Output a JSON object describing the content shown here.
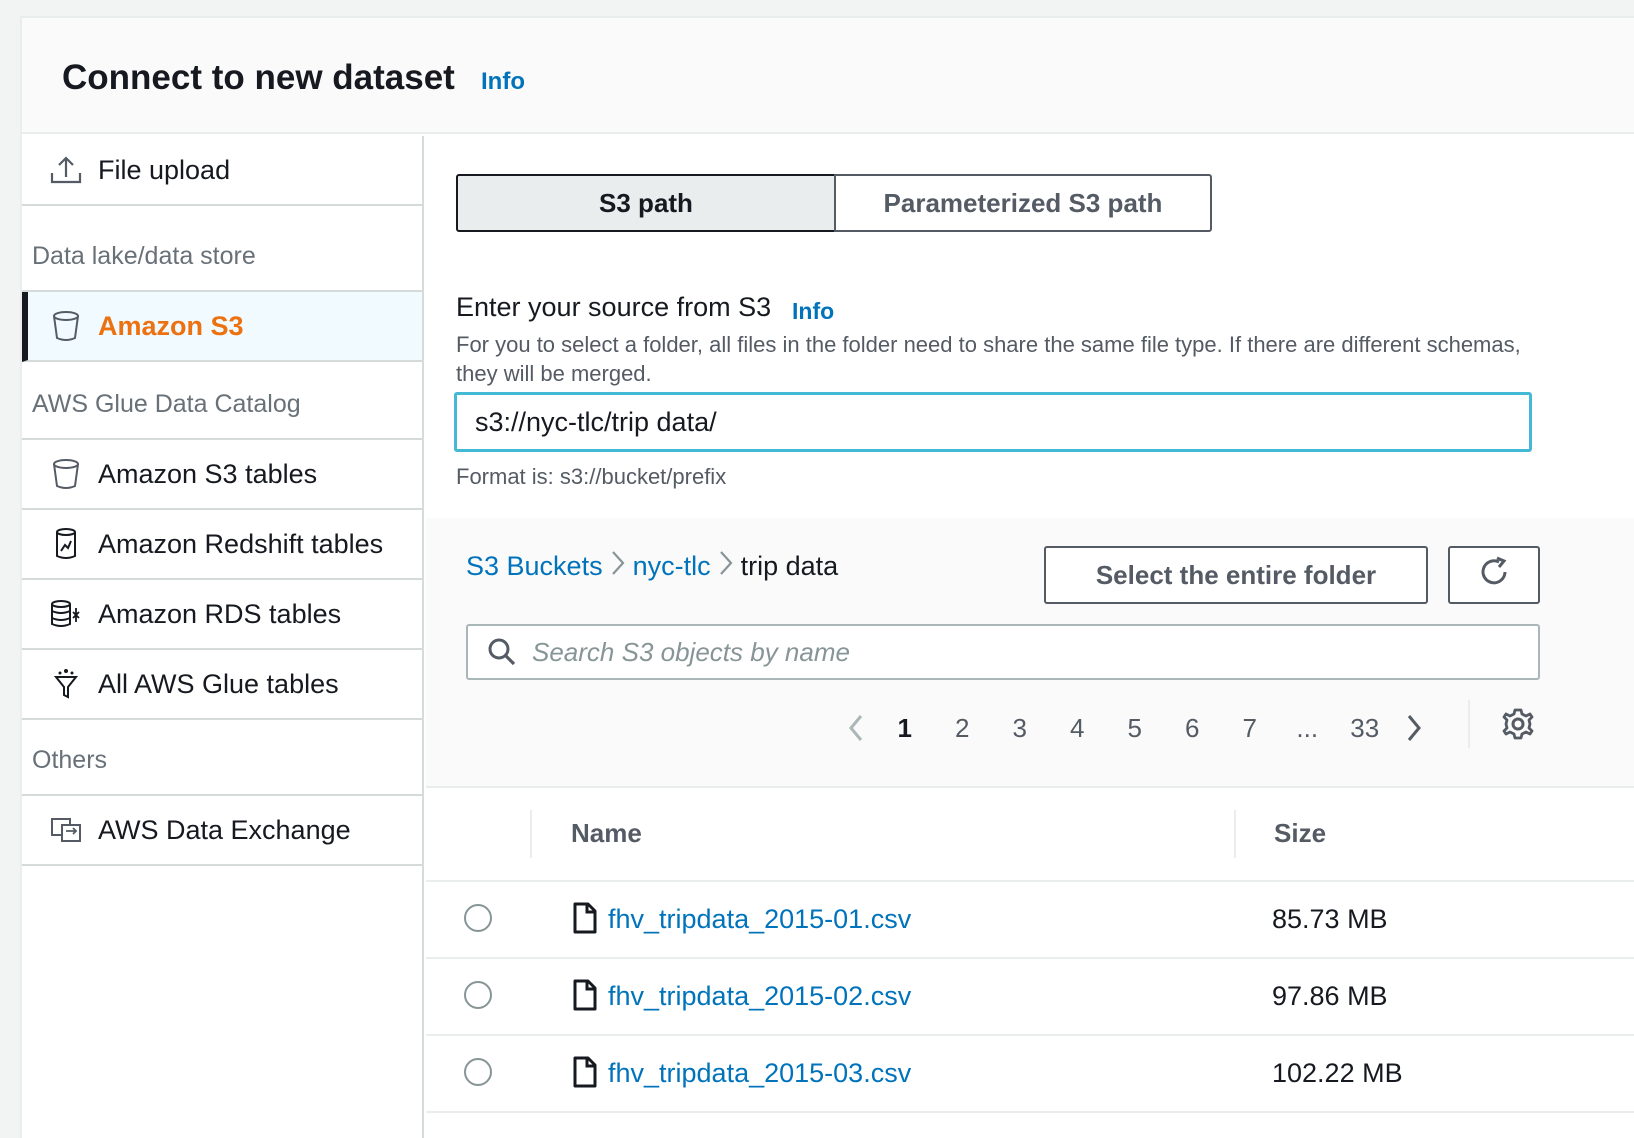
{
  "header": {
    "title": "Connect to new dataset",
    "info": "Info"
  },
  "sidebar": {
    "file_upload": "File upload",
    "group_data_lake": "Data lake/data store",
    "amazon_s3": "Amazon S3",
    "group_glue": "AWS Glue Data Catalog",
    "s3_tables": "Amazon S3 tables",
    "redshift_tables": "Amazon Redshift tables",
    "rds_tables": "Amazon RDS tables",
    "all_glue_tables": "All AWS Glue tables",
    "group_others": "Others",
    "data_exchange": "AWS Data Exchange"
  },
  "segments": {
    "s3_path": "S3 path",
    "param_s3_path": "Parameterized S3 path"
  },
  "source": {
    "label": "Enter your source from S3",
    "info": "Info",
    "description": "For you to select a folder, all files in the folder need to share the same file type. If there are different schemas, they will be merged.",
    "value": "s3://nyc-tlc/trip data/",
    "hint": "Format is: s3://bucket/prefix"
  },
  "browser": {
    "crumbs": [
      "S3 Buckets",
      "nyc-tlc",
      "trip data"
    ],
    "select_folder": "Select the entire folder",
    "search_placeholder": "Search S3 objects by name",
    "pages": [
      "1",
      "2",
      "3",
      "4",
      "5",
      "6",
      "7",
      "...",
      "33"
    ],
    "current_page": "1"
  },
  "table": {
    "col_name": "Name",
    "col_size": "Size",
    "rows": [
      {
        "name": "fhv_tripdata_2015-01.csv",
        "size": "85.73 MB"
      },
      {
        "name": "fhv_tripdata_2015-02.csv",
        "size": "97.86 MB"
      },
      {
        "name": "fhv_tripdata_2015-03.csv",
        "size": "102.22 MB"
      }
    ]
  },
  "colors": {
    "link": "#0073bb",
    "active_orange": "#ec7211",
    "focus": "#44b9d6"
  }
}
